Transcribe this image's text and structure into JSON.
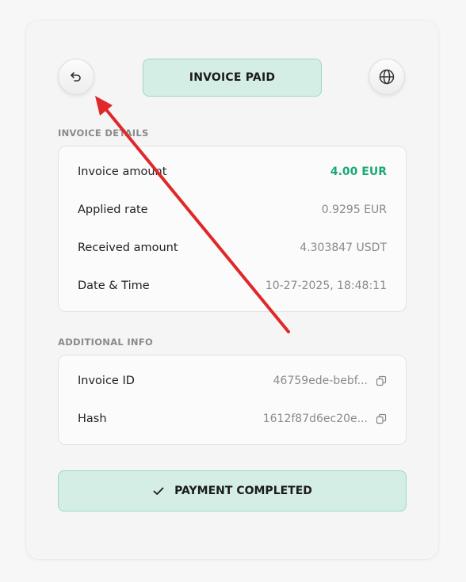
{
  "header": {
    "status_label": "INVOICE PAID",
    "back_icon": "undo-arrow-icon",
    "globe_icon": "globe-icon"
  },
  "invoice_details": {
    "section_label": "INVOICE DETAILS",
    "rows": [
      {
        "label": "Invoice amount",
        "value": "4.00 EUR"
      },
      {
        "label": "Applied rate",
        "value": "0.9295 EUR"
      },
      {
        "label": "Received amount",
        "value": "4.303847 USDT"
      },
      {
        "label": "Date & Time",
        "value": "10-27-2025, 18:48:11"
      }
    ]
  },
  "additional_info": {
    "section_label": "ADDITIONAL INFO",
    "rows": [
      {
        "label": "Invoice ID",
        "value": "46759ede-bebf..."
      },
      {
        "label": "Hash",
        "value": "1612f87d6ec20e..."
      }
    ]
  },
  "footer": {
    "button_label": "PAYMENT COMPLETED"
  },
  "colors": {
    "accent_green": "#1aaa74",
    "status_bg": "#d4eee5",
    "annotation_red": "#e0282a"
  }
}
